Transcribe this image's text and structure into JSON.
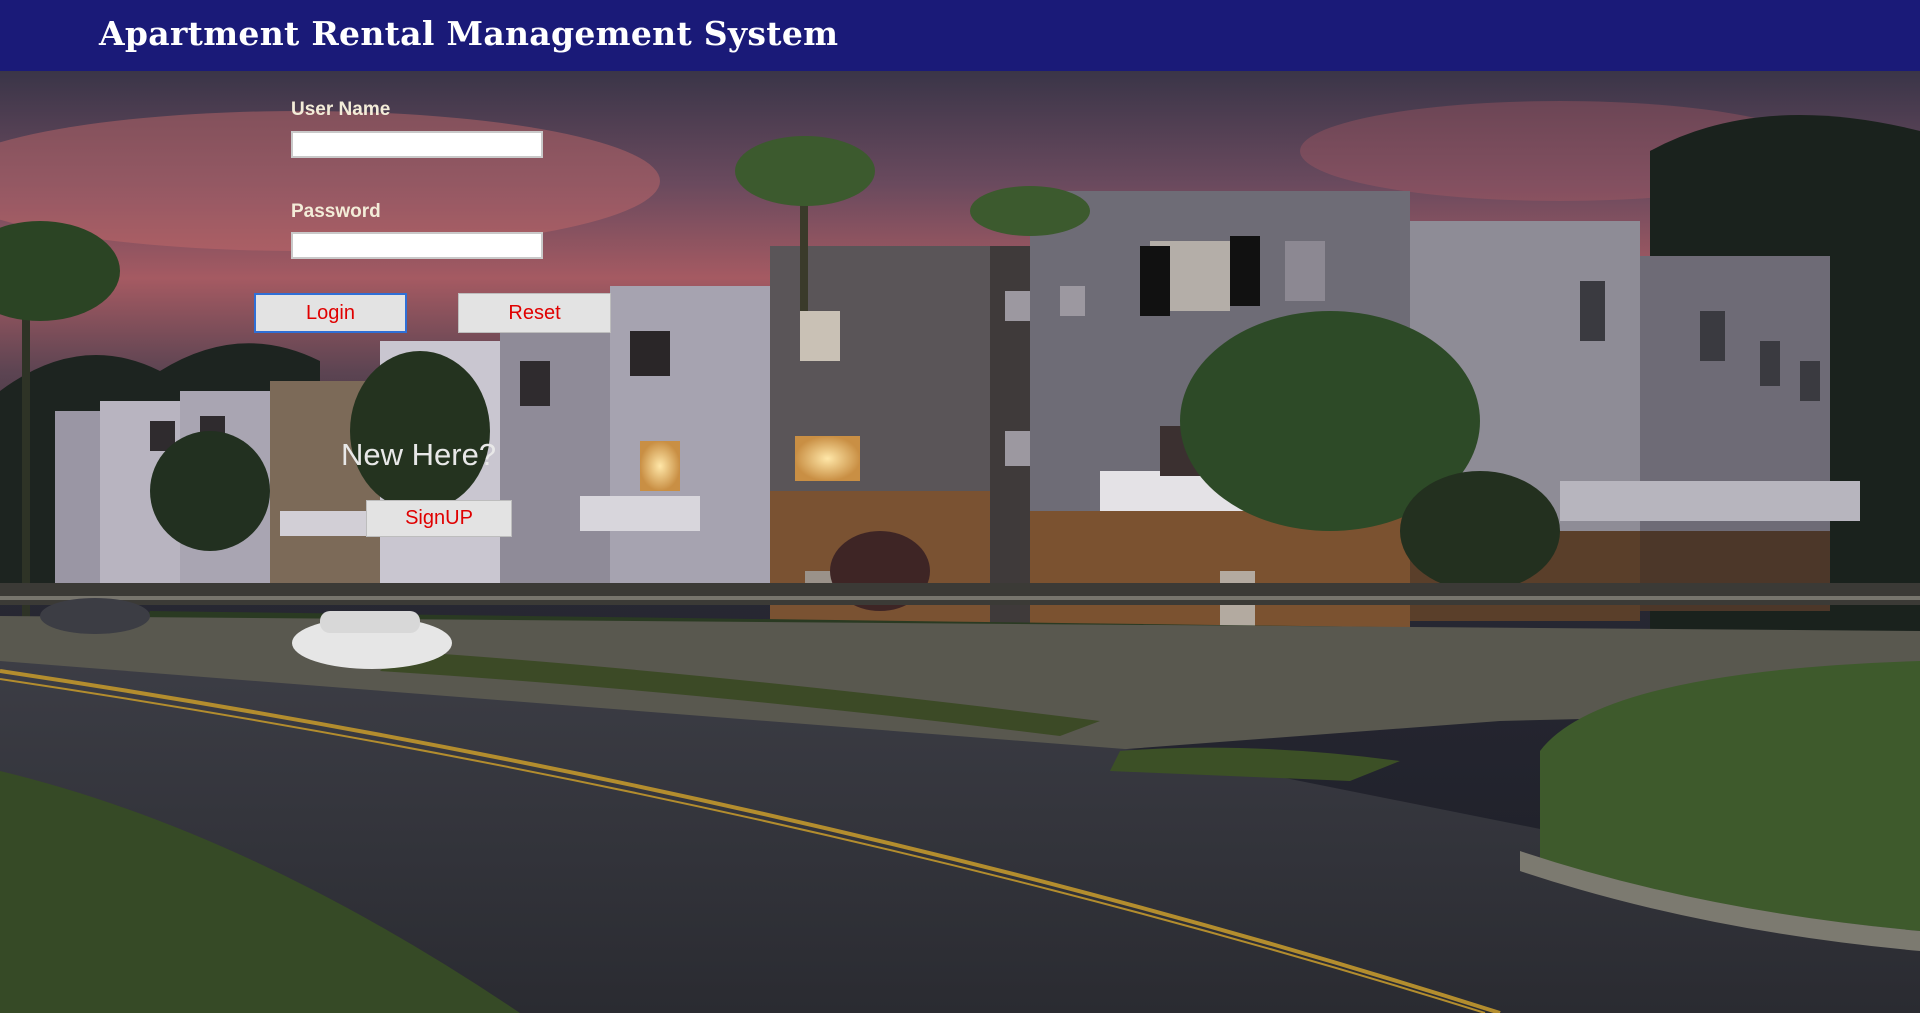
{
  "header": {
    "title": "Apartment Rental Management System"
  },
  "login_form": {
    "username_label": "User Name",
    "username_value": "",
    "password_label": "Password",
    "password_value": "",
    "login_button": "Login",
    "reset_button": "Reset"
  },
  "signup": {
    "prompt": "New Here?",
    "button": "SignUP"
  },
  "colors": {
    "header_bg": "#1a1a78",
    "button_text": "#e00000",
    "button_bg": "#e3e3e3",
    "login_focus_border": "#2f6fd6"
  }
}
